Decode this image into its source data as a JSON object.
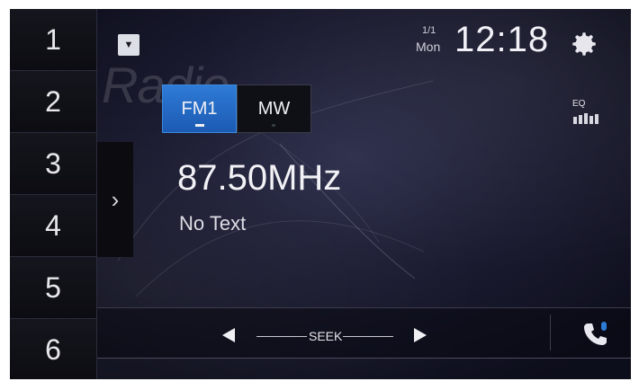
{
  "presets": [
    "1",
    "2",
    "3",
    "4",
    "5",
    "6"
  ],
  "watermark": "Radio",
  "bands": [
    {
      "label": "FM1",
      "active": true
    },
    {
      "label": "MW",
      "active": false
    }
  ],
  "station": {
    "frequency": "87.50MHz",
    "radio_text": "No Text"
  },
  "clock": {
    "date": "1/1",
    "day": "Mon",
    "time": "12:18"
  },
  "eq": {
    "label": "EQ"
  },
  "seek": {
    "label": "SEEK"
  },
  "icons": {
    "settings": "gear-icon",
    "expand": "chevron-right-icon",
    "dropdown": "dropdown-icon",
    "eq": "eq-icon",
    "seek_prev": "triangle-left-icon",
    "seek_next": "triangle-right-icon",
    "phone": "phone-bluetooth-icon"
  },
  "colors": {
    "accent": "#2e7bd6",
    "background": "#15162a"
  }
}
